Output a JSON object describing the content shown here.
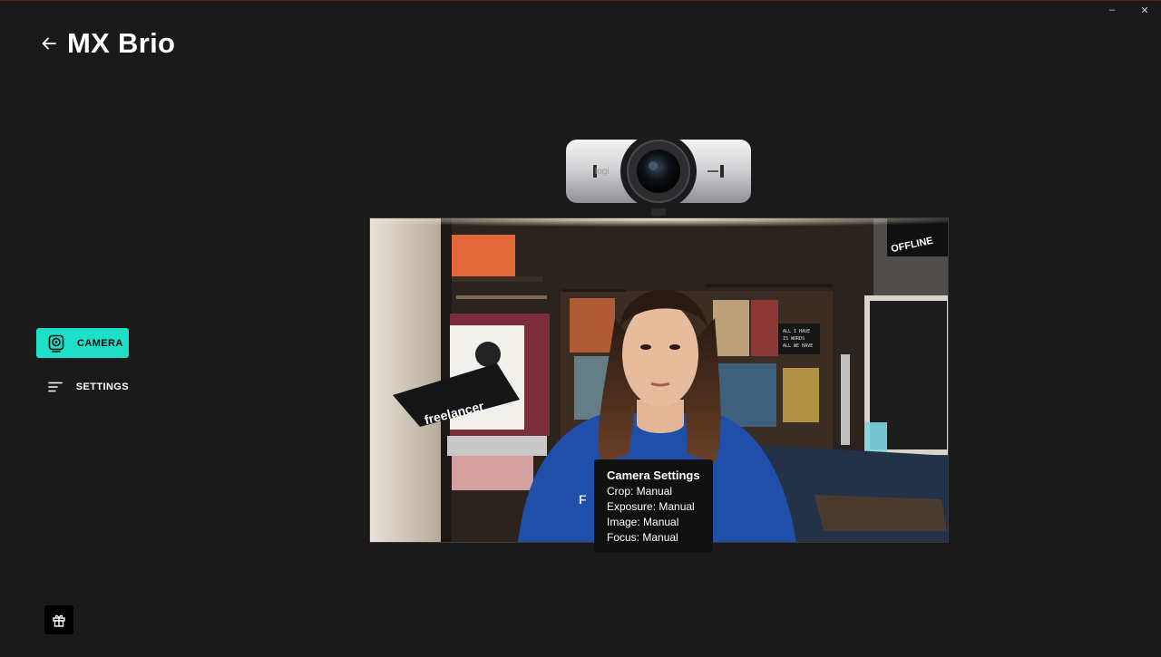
{
  "window": {
    "minimize_glyph": "–",
    "close_glyph": "✕"
  },
  "header": {
    "title": "MX Brio",
    "back_icon": "arrow-left-icon"
  },
  "nav": {
    "items": [
      {
        "label": "CAMERA",
        "icon": "webcam-icon",
        "active": true
      },
      {
        "label": "SETTINGS",
        "icon": "menu-lines-icon",
        "active": false
      }
    ]
  },
  "webcam": {
    "brand": "logi"
  },
  "preview": {
    "laptop_sticker_text": "freelancer",
    "letterboard_text": "ALL I HAVE\nIS WORDS\nALL WE HAVE\nIS WORDS",
    "shirt_text": "F",
    "poster_text": "OFFLINE"
  },
  "tooltip": {
    "title": "Camera Settings",
    "lines": [
      "Crop: Manual",
      "Exposure: Manual",
      "Image: Manual",
      "Focus: Manual"
    ]
  },
  "footer": {
    "feedback_icon": "gift-box-icon"
  },
  "colors": {
    "accent": "#20dfc8",
    "background": "#1a1a1a",
    "tooltip_bg": "#101010"
  }
}
